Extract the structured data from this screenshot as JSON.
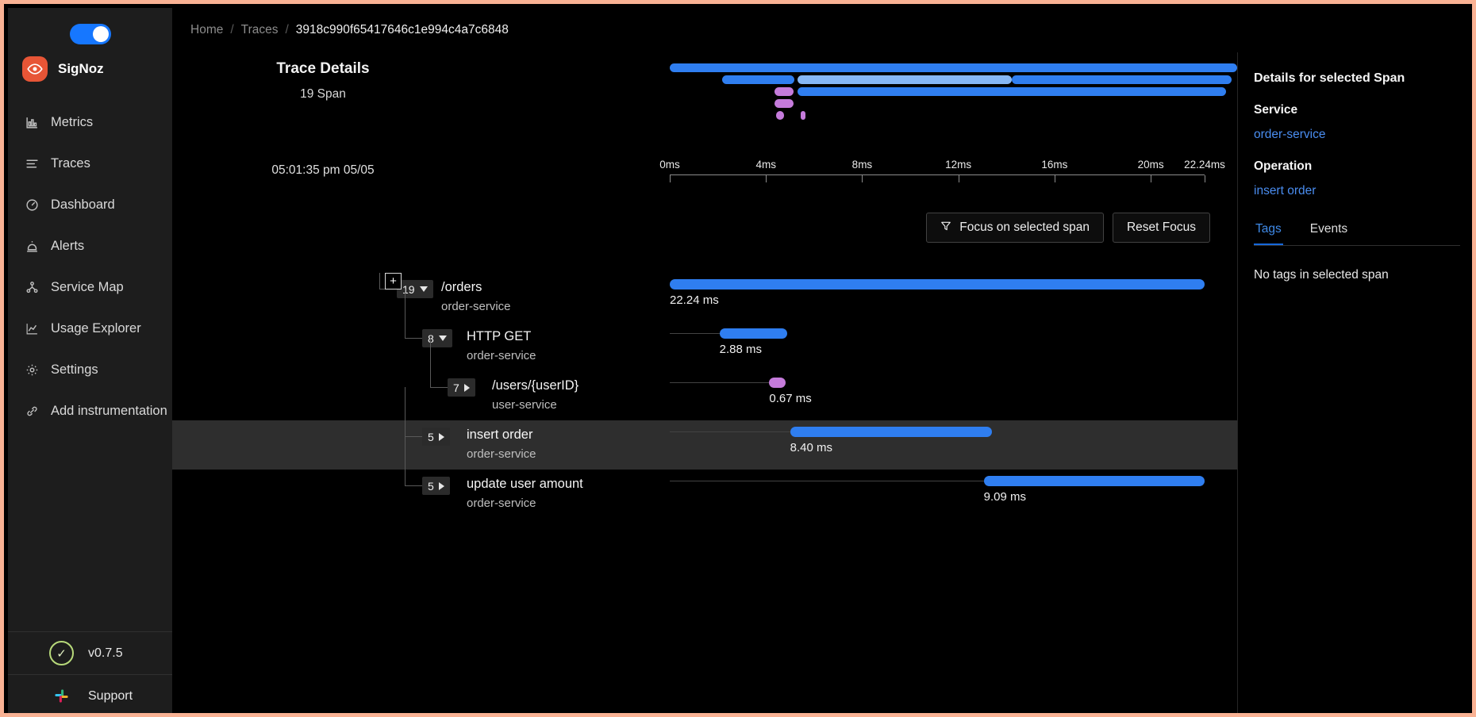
{
  "sidebar": {
    "theme_toggle": {
      "name": "dark-mode-toggle",
      "state": "on"
    },
    "brand": {
      "name": "SigNoz",
      "icon": "eye-icon"
    },
    "items": [
      {
        "label": "Metrics",
        "icon": "bar-chart-icon"
      },
      {
        "label": "Traces",
        "icon": "list-icon"
      },
      {
        "label": "Dashboard",
        "icon": "gauge-icon"
      },
      {
        "label": "Alerts",
        "icon": "alert-bell-icon"
      },
      {
        "label": "Service Map",
        "icon": "nodes-icon"
      },
      {
        "label": "Usage Explorer",
        "icon": "line-chart-icon"
      },
      {
        "label": "Settings",
        "icon": "gear-icon"
      },
      {
        "label": "Add instrumentation",
        "icon": "link-icon"
      }
    ],
    "footer": [
      {
        "label": "v0.7.5",
        "icon": "check-circle-icon"
      },
      {
        "label": "Support",
        "icon": "slack-icon"
      }
    ]
  },
  "breadcrumb": {
    "home": "Home",
    "traces": "Traces",
    "separator": "/",
    "trace_id": "3918c990f65417646c1e994c4a7c6848"
  },
  "overview": {
    "title": "Trace Details",
    "span_count": "19 Span",
    "start_time": "05:01:35 pm 05/05"
  },
  "toolbar": {
    "focus_label": "Focus on selected span",
    "focus_icon": "funnel-icon",
    "reset_label": "Reset Focus"
  },
  "tree": {
    "expand_all_label": "+",
    "rows": [
      {
        "count": "19",
        "caret": "down",
        "name": "/orders",
        "service": "order-service",
        "duration": "22.24 ms",
        "selected": false,
        "depth": 0,
        "bar_start_pct": 0.0,
        "bar_end_pct": 100.0,
        "bar_color": "#2f7ef0"
      },
      {
        "count": "8",
        "caret": "down",
        "name": "HTTP GET",
        "service": "order-service",
        "duration": "2.88 ms",
        "selected": false,
        "depth": 1,
        "bar_start_pct": 9.3,
        "bar_end_pct": 22.0,
        "bar_color": "#2f7ef0"
      },
      {
        "count": "7",
        "caret": "right",
        "name": "/users/{userID}",
        "service": "user-service",
        "duration": "0.67 ms",
        "selected": false,
        "depth": 2,
        "bar_start_pct": 18.6,
        "bar_end_pct": 21.6,
        "bar_color": "#c57bdb"
      },
      {
        "count": "5",
        "caret": "right",
        "name": "insert order",
        "service": "order-service",
        "duration": "8.40 ms",
        "selected": true,
        "depth": 1,
        "bar_start_pct": 22.5,
        "bar_end_pct": 60.3,
        "bar_color": "#2f7ef0"
      },
      {
        "count": "5",
        "caret": "right",
        "name": "update user amount",
        "service": "order-service",
        "duration": "9.09 ms",
        "selected": false,
        "depth": 1,
        "bar_start_pct": 58.7,
        "bar_end_pct": 100.0,
        "bar_color": "#2f7ef0"
      }
    ]
  },
  "chart_data": {
    "type": "bar",
    "title": "Trace Details",
    "subtitle": "19 Span",
    "xlabel": "",
    "ylabel": "",
    "xlim": [
      0,
      22.24
    ],
    "x_unit": "ms",
    "axis_ticks": [
      "0ms",
      "4ms",
      "8ms",
      "12ms",
      "16ms",
      "20ms",
      "22.24ms"
    ],
    "axis_tick_values": [
      0,
      4,
      8,
      12,
      16,
      20,
      22.24
    ],
    "grid": false,
    "legend": "none",
    "categories": [
      "/orders",
      "HTTP GET",
      "/users/{userID}",
      "insert order",
      "update user amount"
    ],
    "values": [
      22.24,
      2.88,
      0.67,
      8.4,
      9.09
    ],
    "value_labels": [
      "22.24 ms",
      "2.88 ms",
      "0.67 ms",
      "8.40 ms",
      "9.09 ms"
    ],
    "services": [
      "order-service",
      "order-service",
      "user-service",
      "order-service",
      "order-service"
    ],
    "child_counts": [
      19,
      8,
      7,
      5,
      5
    ],
    "spans": [
      {
        "name": "/orders",
        "service": "order-service",
        "start_ms": 0.0,
        "duration_ms": 22.24,
        "color": "#2f7ef0"
      },
      {
        "name": "HTTP GET",
        "service": "order-service",
        "start_ms": 2.07,
        "duration_ms": 2.88,
        "color": "#2f7ef0"
      },
      {
        "name": "/users/{userID}",
        "service": "user-service",
        "start_ms": 4.14,
        "duration_ms": 0.67,
        "color": "#c57bdb"
      },
      {
        "name": "insert order",
        "service": "order-service",
        "start_ms": 5.0,
        "duration_ms": 8.4,
        "color": "#2f7ef0"
      },
      {
        "name": "update user amount",
        "service": "order-service",
        "start_ms": 13.05,
        "duration_ms": 9.09,
        "color": "#2f7ef0"
      }
    ],
    "minimap_bars": [
      {
        "start_pct": 0.0,
        "end_pct": 100.0,
        "row": 0,
        "color": "#2f7ef0"
      },
      {
        "start_pct": 9.3,
        "end_pct": 22.0,
        "row": 1,
        "color": "#2f7ef0"
      },
      {
        "start_pct": 22.5,
        "end_pct": 60.3,
        "row": 1,
        "color": "#86b7f5"
      },
      {
        "start_pct": 60.3,
        "end_pct": 99.0,
        "row": 1,
        "color": "#2f7ef0"
      },
      {
        "start_pct": 18.4,
        "end_pct": 21.8,
        "row": 2,
        "color": "#c57bdb"
      },
      {
        "start_pct": 22.5,
        "end_pct": 98.0,
        "row": 2,
        "color": "#2f7ef0"
      },
      {
        "start_pct": 18.4,
        "end_pct": 21.8,
        "row": 3,
        "color": "#c57bdb"
      },
      {
        "start_pct": 18.8,
        "end_pct": 20.2,
        "row": 4,
        "color": "#c57bdb"
      },
      {
        "start_pct": 23.1,
        "end_pct": 23.9,
        "row": 4,
        "color": "#c57bdb"
      }
    ]
  },
  "details_panel": {
    "title": "Details for selected Span",
    "service_heading": "Service",
    "service_value": "order-service",
    "operation_heading": "Operation",
    "operation_value": "insert order",
    "tabs": [
      {
        "label": "Tags",
        "active": true
      },
      {
        "label": "Events",
        "active": false
      }
    ],
    "empty_message": "No tags in selected span"
  },
  "colors": {
    "accent_blue": "#2f7ef0",
    "accent_blue_light": "#86b7f5",
    "accent_purple": "#c57bdb",
    "brand_orange": "#e75536",
    "link_blue": "#4a8df0",
    "background": "#000000",
    "sidebar_background": "#1d1d1d",
    "selected_row": "#2e2e2e"
  }
}
